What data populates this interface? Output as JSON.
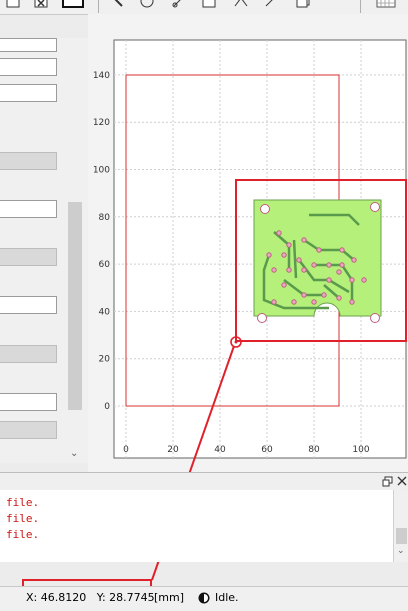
{
  "toolbar": {
    "icons": [
      "checkbox-icon",
      "delete-icon",
      "rectangle-icon",
      "pointer-icon",
      "circle-icon",
      "pen-icon",
      "square-icon",
      "path-icon",
      "copy-icon",
      "grid-icon"
    ]
  },
  "plot": {
    "x_ticks": [
      "0",
      "20",
      "40",
      "60",
      "80",
      "100"
    ],
    "y_ticks": [
      "0",
      "20",
      "40",
      "60",
      "80",
      "100",
      "120",
      "140"
    ]
  },
  "console": {
    "lines": [
      "file.",
      "file.",
      "file."
    ]
  },
  "status": {
    "coordinates": "X: 46.8120   Y: 28.7745",
    "units": "[mm]",
    "state": "Idle."
  },
  "colors": {
    "annotation": "#e0202a",
    "pcb": "#b5f07a",
    "trace": "#5a9a4c",
    "console_text": "#cc1414"
  }
}
